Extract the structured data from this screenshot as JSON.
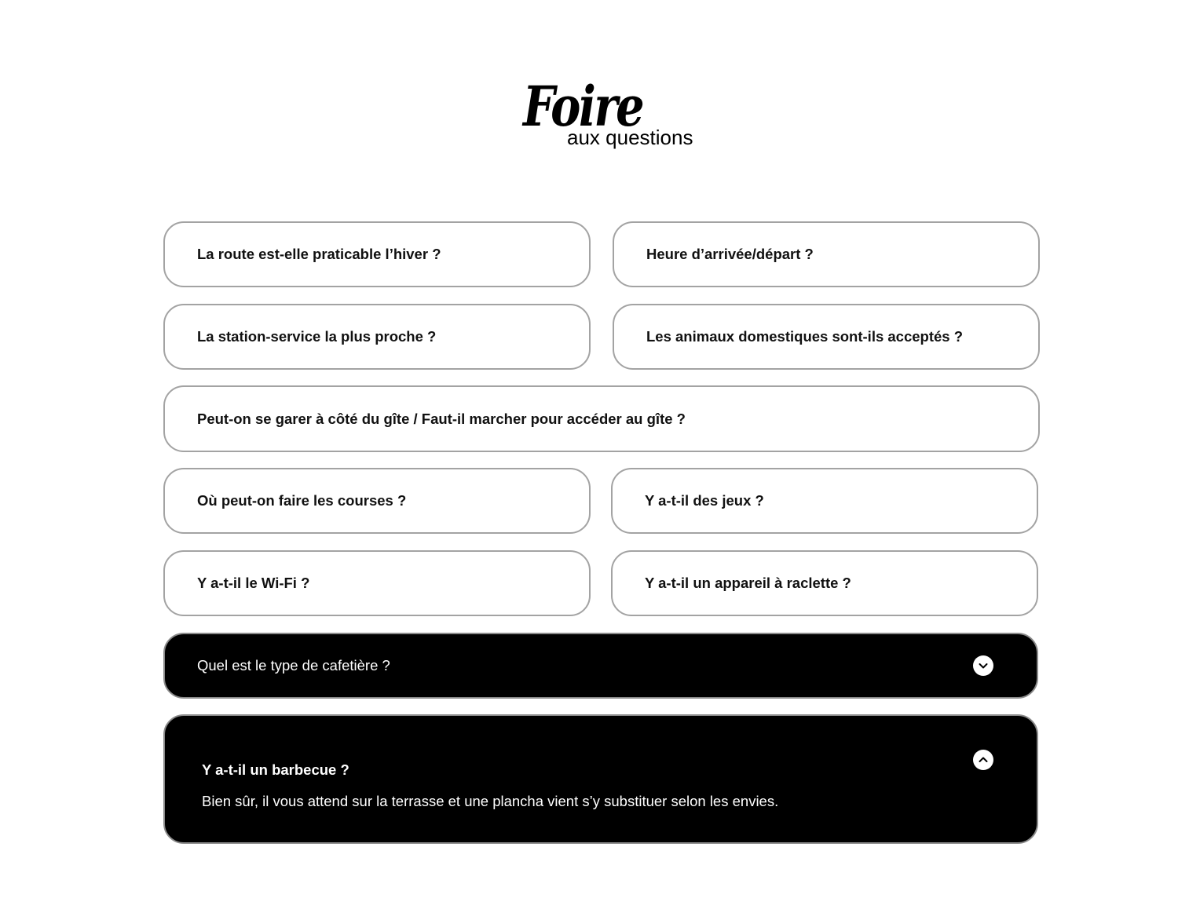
{
  "header": {
    "title_script": "Foire",
    "title_sub": "aux questions"
  },
  "faq": {
    "items": [
      {
        "question": "La route est-elle praticable l’hiver ?",
        "expanded": false
      },
      {
        "question": "Heure d’arrivée/départ ?",
        "expanded": false
      },
      {
        "question": "La station-service la plus proche ?",
        "expanded": false
      },
      {
        "question": "Les animaux domestiques sont-ils acceptés ?",
        "expanded": false
      },
      {
        "question": "Peut-on se garer à côté du gîte / Faut-il marcher pour accéder au gîte ?",
        "expanded": false
      },
      {
        "question": "Où peut-on faire les courses ?",
        "expanded": false
      },
      {
        "question": "Y a-t-il des jeux ?",
        "expanded": false
      },
      {
        "question": "Y a-t-il le Wi-Fi ?",
        "expanded": false
      },
      {
        "question": "Y a-t-il un appareil à raclette ?",
        "expanded": false
      },
      {
        "question": "Quel est le type de cafetière ?",
        "expanded": false,
        "icon": "chevron-down-icon"
      },
      {
        "question": "Y a-t-il un barbecue ?",
        "expanded": true,
        "icon": "chevron-up-icon",
        "answer": "Bien sûr, il vous attend sur la terrasse et une plancha vient s’y substituer selon les envies."
      }
    ]
  },
  "colors": {
    "border": "#a3a3a3",
    "active_background": "#000000",
    "active_text": "#ffffff"
  }
}
